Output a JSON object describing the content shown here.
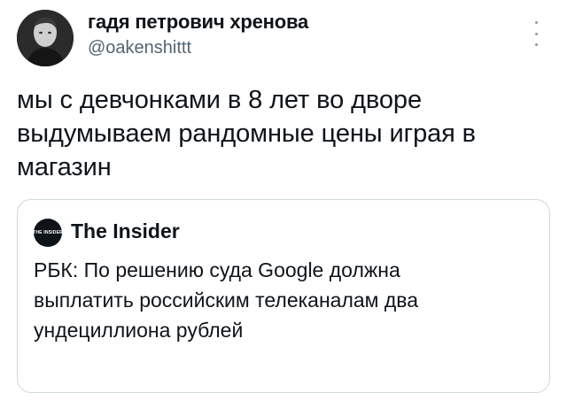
{
  "author": {
    "name": "гадя петрович хренова",
    "handle": "@oakenshittt",
    "avatar_icon": "person-portrait-icon"
  },
  "more_icon": "vertical-ellipsis-icon",
  "tweet": {
    "text": "мы с девчонками в 8 лет во дворе\nвыдумываем рандомные цены играя в\nмагазин"
  },
  "quote": {
    "logo_text": "THE INSIDER",
    "source_name": "The Insider",
    "text": "РБК: По решению суда Google должна\nвыплатить российским телеканалам два\nундециллиона рублей"
  },
  "colors": {
    "text": "#0f1419",
    "secondary_text": "#536471",
    "border": "#cfd9de",
    "background": "#ffffff"
  }
}
